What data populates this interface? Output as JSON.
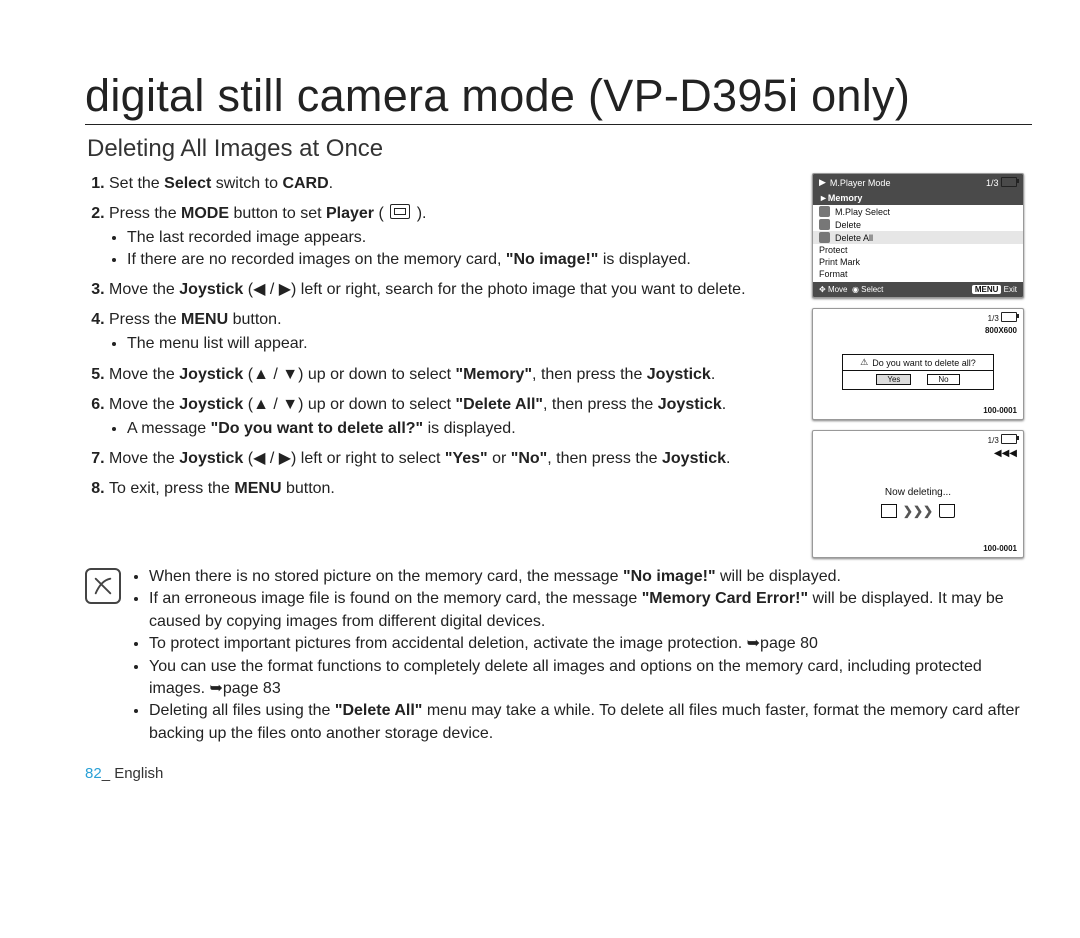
{
  "title": "digital still camera mode (VP-D395i only)",
  "subtitle": "Deleting All Images at Once",
  "steps": {
    "s1": {
      "pre": "Set the ",
      "b1": "Select",
      "mid": " switch to ",
      "b2": "CARD",
      "post": "."
    },
    "s2": {
      "pre": "Press the ",
      "b1": "MODE",
      "mid": " button to set ",
      "b2": "Player",
      "post": " ( ",
      "post2": " )."
    },
    "s2b1": "The last recorded image appears.",
    "s2b2a": "If there are no recorded images on the memory card, ",
    "s2b2b": "\"No image!\"",
    "s2b2c": " is displayed.",
    "s3a": "Move the ",
    "s3b": "Joystick",
    "s3c": " (◀ / ▶) left or right, search for the photo image that you want to delete.",
    "s4a": "Press the ",
    "s4b": "MENU",
    "s4c": " button.",
    "s4bul": "The menu list will appear.",
    "s5a": "Move the ",
    "s5b": "Joystick",
    "s5c": " (▲ / ▼) up or down to select ",
    "s5d": "\"Memory\"",
    "s5e": ", then press the ",
    "s5f": "Joystick",
    "s5g": ".",
    "s6a": "Move the ",
    "s6b": "Joystick",
    "s6c": " (▲ / ▼) up or down to select ",
    "s6d": "\"Delete All\"",
    "s6e": ", then press the ",
    "s6f": "Joystick",
    "s6g": ".",
    "s6bul_a": "A message ",
    "s6bul_b": "\"Do you want to delete all?\"",
    "s6bul_c": " is displayed.",
    "s7a": "Move the ",
    "s7b": "Joystick",
    "s7c": " (◀ / ▶) left or right to select ",
    "s7d": "\"Yes\"",
    "s7e": " or ",
    "s7f": "\"No\"",
    "s7g": ", then press the ",
    "s7h": "Joystick",
    "s7i": ".",
    "s8a": "To exit, press the ",
    "s8b": "MENU",
    "s8c": " button."
  },
  "notes": {
    "n1a": "When there is no stored picture on the memory card, the message ",
    "n1b": "\"No image!\"",
    "n1c": " will be displayed.",
    "n2a": "If an erroneous image file is found on the memory card, the message ",
    "n2b": "\"Memory Card Error!\"",
    "n2c": " will be displayed. It may be caused by copying images from different digital devices.",
    "n3": "To protect important pictures from accidental deletion, activate the image protection. ➥page 80",
    "n4": "You can use the format functions to completely delete all images and options on the memory card, including protected images. ➥page 83",
    "n5a": "Deleting all files using the ",
    "n5b": "\"Delete All\"",
    "n5c": " menu may take a while. To delete all files much faster, format the memory card after backing up the files onto another storage device."
  },
  "footer": {
    "page": "82",
    "sep": "_ ",
    "lang": "English"
  },
  "screens": {
    "s1": {
      "mode": "M.Player Mode",
      "counter": "1/3",
      "tab": "►Memory",
      "items": [
        "M.Play Select",
        "Delete",
        "Delete All",
        "Protect",
        "Print Mark",
        "Format"
      ],
      "selected_index": 2,
      "ftr_move": "Move",
      "ftr_select": "Select",
      "ftr_menu": "MENU",
      "ftr_exit": "Exit"
    },
    "s2": {
      "counter": "1/3",
      "res": "800X600",
      "dialog_text": "Do you want to delete all?",
      "yes": "Yes",
      "no": "No",
      "imgnum": "100-0001"
    },
    "s3": {
      "counter": "1/3",
      "fast": "◀◀◀",
      "now": "Now deleting...",
      "imgnum": "100-0001"
    }
  }
}
